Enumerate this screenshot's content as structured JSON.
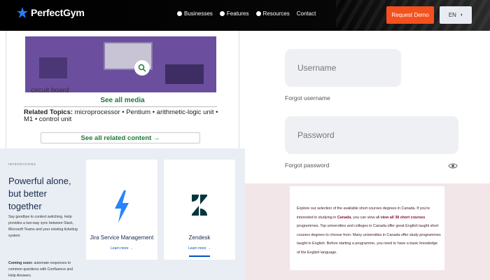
{
  "nav": {
    "brand": "PerfectGym",
    "links": [
      {
        "label": "Businesses"
      },
      {
        "label": "Features"
      },
      {
        "label": "Resources"
      },
      {
        "label": "Contact"
      }
    ],
    "request_demo": "Request Demo",
    "language": "EN",
    "colors": {
      "accent": "#f4511e",
      "logo_star": "#2a7cf6"
    }
  },
  "article": {
    "image_caption": "circuit board",
    "see_all_media": "See all media",
    "related_label": "Related Topics:",
    "related_topics_text": "microprocessor • Pentium • arithmetic-logic unit • M1 • control unit",
    "see_related": "See all related content →"
  },
  "integrations": {
    "eyebrow": "INTEGRATIONS",
    "heading": "Powerful alone, but better together",
    "description": "Say goodbye to context switching. Help provides a two-way sync between Slack, Microsoft Teams and your existing ticketing system.",
    "coming_soon_label": "Coming soon:",
    "coming_soon_text": "automate responses to common questions with Confluence and Help Answers.",
    "cards": [
      {
        "name": "Jira Service Management",
        "link": "Learn more →",
        "icon": "lightning-icon"
      },
      {
        "name": "Zendesk",
        "link": "Learn more →",
        "icon": "zendesk-icon"
      }
    ]
  },
  "login": {
    "username_placeholder": "Username",
    "forgot_username": "Forgot username",
    "password_placeholder": "Password",
    "forgot_password": "Forgot password"
  },
  "courses": {
    "text_before": "Explore our selection of the available short courses degrees in Canada. If you're interested in studying in ",
    "canada_link": "Canada",
    "text_middle": ", you can view all ",
    "view_all_link": "view all 38 short courses",
    "text_after": " programmes. Top universities and colleges in Canada offer great English taught short courses degrees to choose from. Many universities in Canada offer study programmes taught in English. Before starting a programme, you need to have a basic knowledge of the English language."
  }
}
